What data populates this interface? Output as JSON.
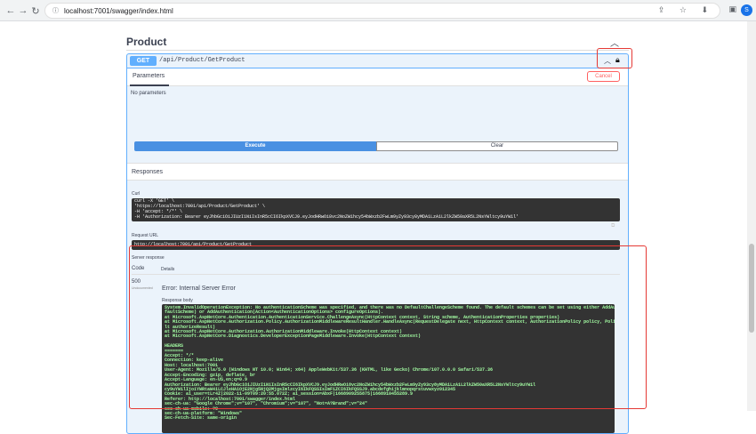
{
  "browser": {
    "url": "localhost:7001/swagger/index.html",
    "avatar_letter": "S",
    "right_icons": "⇪ ☆ ⬇"
  },
  "section": {
    "title": "Product"
  },
  "operation": {
    "method": "GET",
    "path": "/api/Product/GetProduct",
    "parameters_label": "Parameters",
    "cancel_label": "Cancel",
    "no_parameters": "No parameters",
    "execute_label": "Execute",
    "clear_label": "Clear",
    "responses_label": "Responses"
  },
  "curl": {
    "label": "Curl",
    "lines": [
      "curl -X 'GET' \\",
      "  'https://localhost:7001/api/Product/GetProduct' \\",
      "  -H 'accept: */*' \\",
      "  -H 'Authorization: Bearer eyJhbGciOiJIUzI1NiIsInR5cCI6IkpXVCJ9.eyJodHRwOi8vc2NoZW1hcy54bWxzb2FwLm9yZy93cy8yMDA1LzA1L2lkZW50aXR5L2NsYWltcy9uYW1l'"
    ]
  },
  "request_url": {
    "label": "Request URL",
    "value": "http://localhost:7001/api/Product/GetProduct"
  },
  "server_response": {
    "label": "Server response",
    "code_header": "Code",
    "details_header": "Details",
    "status_code": "500",
    "status_note": "Undocumented",
    "error_title": "Error: Internal Server Error",
    "body_label": "Response body",
    "body_lines": [
      "System.InvalidOperationException: No authenticationScheme was specified, and there was no DefaultChallengeScheme found. The default schemes can be set using either AddAuthentication(string de",
      "faultScheme) or AddAuthentication(Action<AuthenticationOptions> configureOptions).",
      "   at Microsoft.AspNetCore.Authentication.AuthenticationService.ChallengeAsync(HttpContext context, String scheme, AuthenticationProperties properties)",
      "   at Microsoft.AspNetCore.Authorization.Policy.AuthorizationMiddlewareResultHandler.HandleAsync(RequestDelegate next, HttpContext context, AuthorizationPolicy policy, PolicyAuthorizationResu",
      "lt authorizeResult)",
      "   at Microsoft.AspNetCore.Authorization.AuthorizationMiddleware.Invoke(HttpContext context)",
      "   at Microsoft.AspNetCore.Diagnostics.DeveloperExceptionPageMiddleware.Invoke(HttpContext context)",
      "",
      "HEADERS",
      "=======",
      "Accept: */*",
      "Connection: keep-alive",
      "Host: localhost:7001",
      "User-Agent: Mozilla/5.0 (Windows NT 10.0; Win64; x64) AppleWebKit/537.36 (KHTML, like Gecko) Chrome/107.0.0.0 Safari/537.36",
      "Accept-Encoding: gzip, deflate, br",
      "Accept-Language: en-US,en;q=0.9",
      "Authorization: Bearer eyJhbGciOiJIUzI1NiIsInR5cCI6IkpXVCJ9.eyJodHRwOi8vc2NoZW1hcy54bWxzb2FwLm9yZy93cy8yMDA1LzA1L2lkZW50aXR5L2NsYWltcy9uYW1l",
      "cy9uYW1lIjoiYWRtaW4iLCJleHAiOjE2Njg5NjQ2MjgsImlzcyI6IkFQSSIsImF1ZCI6IkFQSSJ9.abcdefghijklmnopqrstuvwxyz012345",
      "Cookie: ai_user=tLr4Z|2022-11-09T09:20:55.072Z; ai_session=AbxF|1668909255875|1668910455289.9",
      "Referer: http://localhost:7001/swagger/index.html",
      "sec-ch-ua: \"Google Chrome\";v=\"107\", \"Chromium\";v=\"107\", \"Not=A?Brand\";v=\"24\"",
      "sec-ch-ua-mobile: ?0",
      "sec-ch-ua-platform: \"Windows\"",
      "Sec-Fetch-Site: same-origin"
    ]
  },
  "colors": {
    "get_blue": "#61affe",
    "execute_blue": "#4990e2",
    "cancel_red": "#ff6060",
    "highlight_red": "#e53935"
  }
}
